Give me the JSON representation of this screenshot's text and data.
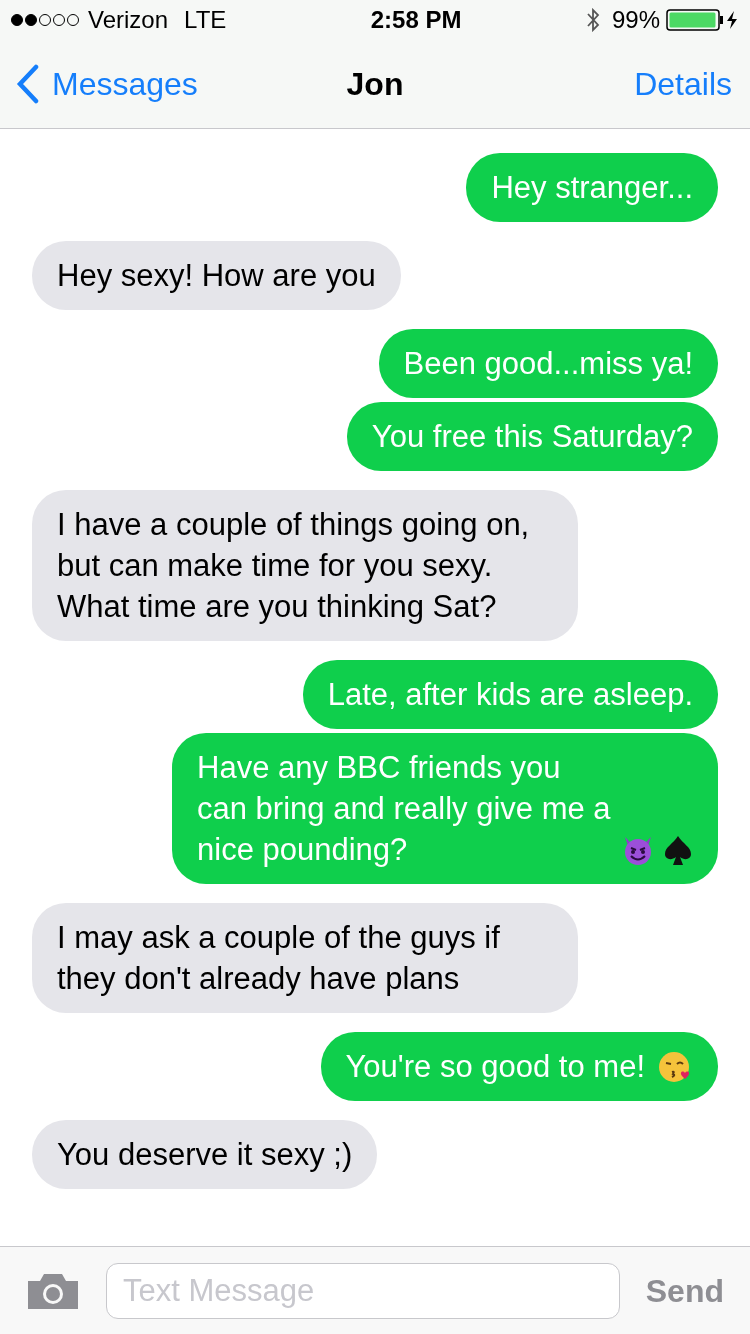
{
  "status_bar": {
    "carrier": "Verizon",
    "network": "LTE",
    "time": "2:58 PM",
    "battery": "99%"
  },
  "nav": {
    "back": "Messages",
    "title": "Jon",
    "action": "Details"
  },
  "messages": [
    {
      "kind": "sent",
      "text": "Hey stranger..."
    },
    {
      "kind": "received",
      "text": "Hey sexy! How are you"
    },
    {
      "kind": "sent",
      "text": "Been good...miss ya!"
    },
    {
      "kind": "sent",
      "text": "You free this Saturday?"
    },
    {
      "kind": "received",
      "text": "I have a couple of things going on, but can make time for you sexy. What time are you thinking Sat?"
    },
    {
      "kind": "sent",
      "text": "Late, after kids are asleep."
    },
    {
      "kind": "sent",
      "text": "Have any BBC friends you can bring and really give me a nice pounding?",
      "icons": [
        {
          "kind": "devil"
        },
        {
          "kind": "spade"
        }
      ]
    },
    {
      "kind": "received",
      "text": "I may ask a couple of the guys if they don't already have plans"
    },
    {
      "kind": "sent",
      "text": "You're so good to me!",
      "icons": [
        {
          "kind": "kiss"
        }
      ]
    },
    {
      "kind": "received",
      "text": "You deserve it sexy ;)"
    }
  ],
  "composer": {
    "placeholder": "Text Message",
    "send": "Send",
    "send_disabled": true
  }
}
